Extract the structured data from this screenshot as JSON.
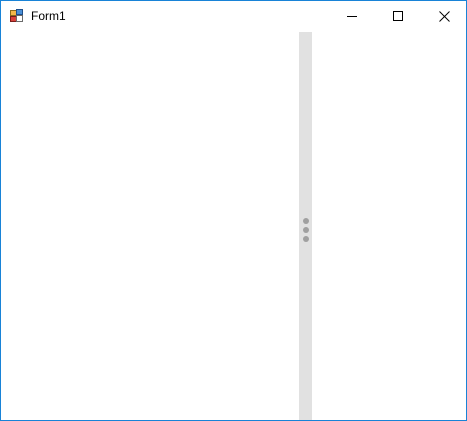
{
  "window": {
    "title": "Form1",
    "icon": "winforms-form-icon",
    "border_color": "#1883d7"
  },
  "caption_buttons": {
    "minimize": "minimize-icon",
    "maximize": "maximize-icon",
    "close": "close-icon"
  },
  "splitter": {
    "color": "#e1e1e1",
    "grip_color": "#a0a0a0",
    "grip_icon": "vertical-grip-dots-icon"
  }
}
